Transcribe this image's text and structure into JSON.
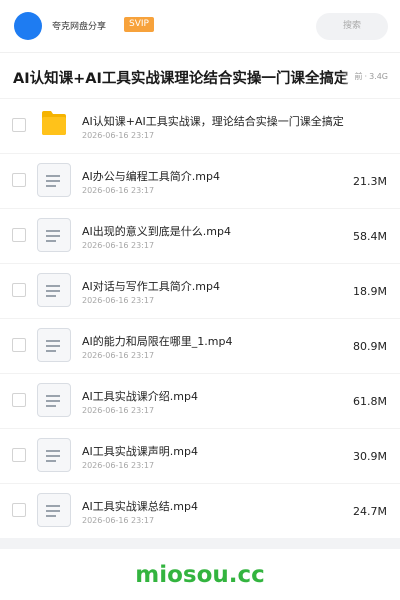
{
  "header": {
    "user_name": "夸克网盘分享",
    "badge": "SVIP",
    "search_label": "搜索"
  },
  "folder": {
    "title": "AI认知课+AI工具实战课理论结合实操一门课全搞定",
    "meta_prefix": "前",
    "meta_size": "3.4G"
  },
  "files": [
    {
      "name": "AI认知课+AI工具实战课，理论结合实操一门课全搞定",
      "date": "2026-06-16 23:17",
      "size": "",
      "icon": "folder-icon"
    },
    {
      "name": "AI办公与编程工具简介.mp4",
      "date": "2026-06-16 23:17",
      "size": "21.3M",
      "icon": "document-icon"
    },
    {
      "name": "AI出现的意义到底是什么.mp4",
      "date": "2026-06-16 23:17",
      "size": "58.4M",
      "icon": "document-icon"
    },
    {
      "name": "AI对话与写作工具简介.mp4",
      "date": "2026-06-16 23:17",
      "size": "18.9M",
      "icon": "document-icon"
    },
    {
      "name": "AI的能力和局限在哪里_1.mp4",
      "date": "2026-06-16 23:17",
      "size": "80.9M",
      "icon": "document-icon"
    },
    {
      "name": "AI工具实战课介绍.mp4",
      "date": "2026-06-16 23:17",
      "size": "61.8M",
      "icon": "document-icon"
    },
    {
      "name": "AI工具实战课声明.mp4",
      "date": "2026-06-16 23:17",
      "size": "30.9M",
      "icon": "document-icon"
    },
    {
      "name": "AI工具实战课总结.mp4",
      "date": "2026-06-16 23:17",
      "size": "24.7M",
      "icon": "document-icon"
    }
  ],
  "watermark": "miosou.cc",
  "colors": {
    "accent_blue": "#1e7cf2",
    "svip_orange": "#f7a23b",
    "folder_yellow": "#ffc21a",
    "watermark_green": "#33b43f"
  }
}
